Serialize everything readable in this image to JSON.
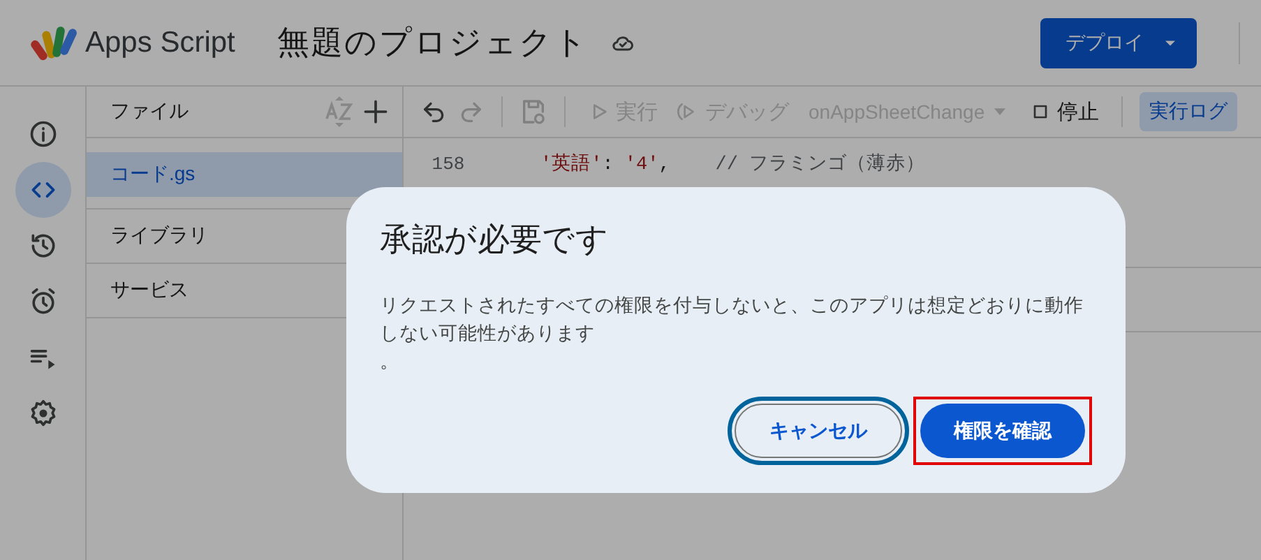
{
  "header": {
    "app_name": "Apps Script",
    "project_title": "無題のプロジェクト",
    "deploy_button": "デプロイ"
  },
  "rail": [
    {
      "selected": false
    },
    {
      "selected": true
    },
    {
      "selected": false
    },
    {
      "selected": false
    },
    {
      "selected": false
    },
    {
      "selected": false
    }
  ],
  "files_panel": {
    "title": "ファイル",
    "files": [
      {
        "name": "コード.gs",
        "selected": true
      }
    ],
    "sections": [
      "ライブラリ",
      "サービス"
    ]
  },
  "toolbar": [
    {
      "kind": "icon",
      "disabled": false
    },
    {
      "kind": "icon",
      "disabled": true
    },
    {
      "kind": "sep"
    },
    {
      "kind": "icon",
      "disabled": true
    },
    {
      "kind": "sep"
    },
    {
      "kind": "button",
      "label": "実行",
      "disabled": true
    },
    {
      "kind": "button",
      "label": "デバッグ",
      "disabled": true
    },
    {
      "kind": "dropdown",
      "label": "onAppSheetChange",
      "disabled": true
    },
    {
      "kind": "button",
      "label": "停止",
      "disabled": false
    },
    {
      "kind": "sep"
    },
    {
      "kind": "toggle",
      "label": "実行ログ",
      "selected": true
    }
  ],
  "code": [
    {
      "number": "158",
      "tokens": [
        {
          "kind": "string",
          "text": "'英語'"
        },
        {
          "kind": "plain",
          "text": ": "
        },
        {
          "kind": "string",
          "text": "'4'"
        },
        {
          "kind": "plain",
          "text": ",    "
        },
        {
          "kind": "comment",
          "text": "// フラミンゴ（薄赤）"
        }
      ]
    }
  ],
  "dialog": {
    "title": "承認が必要です",
    "body": "リクエストされたすべての権限を付与しないと、このアプリは想定どおりに動作しない可能性があります",
    "body_end": "。",
    "buttons": [
      {
        "label": "キャンセル",
        "kind": "outlined",
        "focused": true,
        "highlighted": false
      },
      {
        "label": "権限を確認",
        "kind": "filled",
        "focused": false,
        "highlighted": true
      }
    ]
  }
}
